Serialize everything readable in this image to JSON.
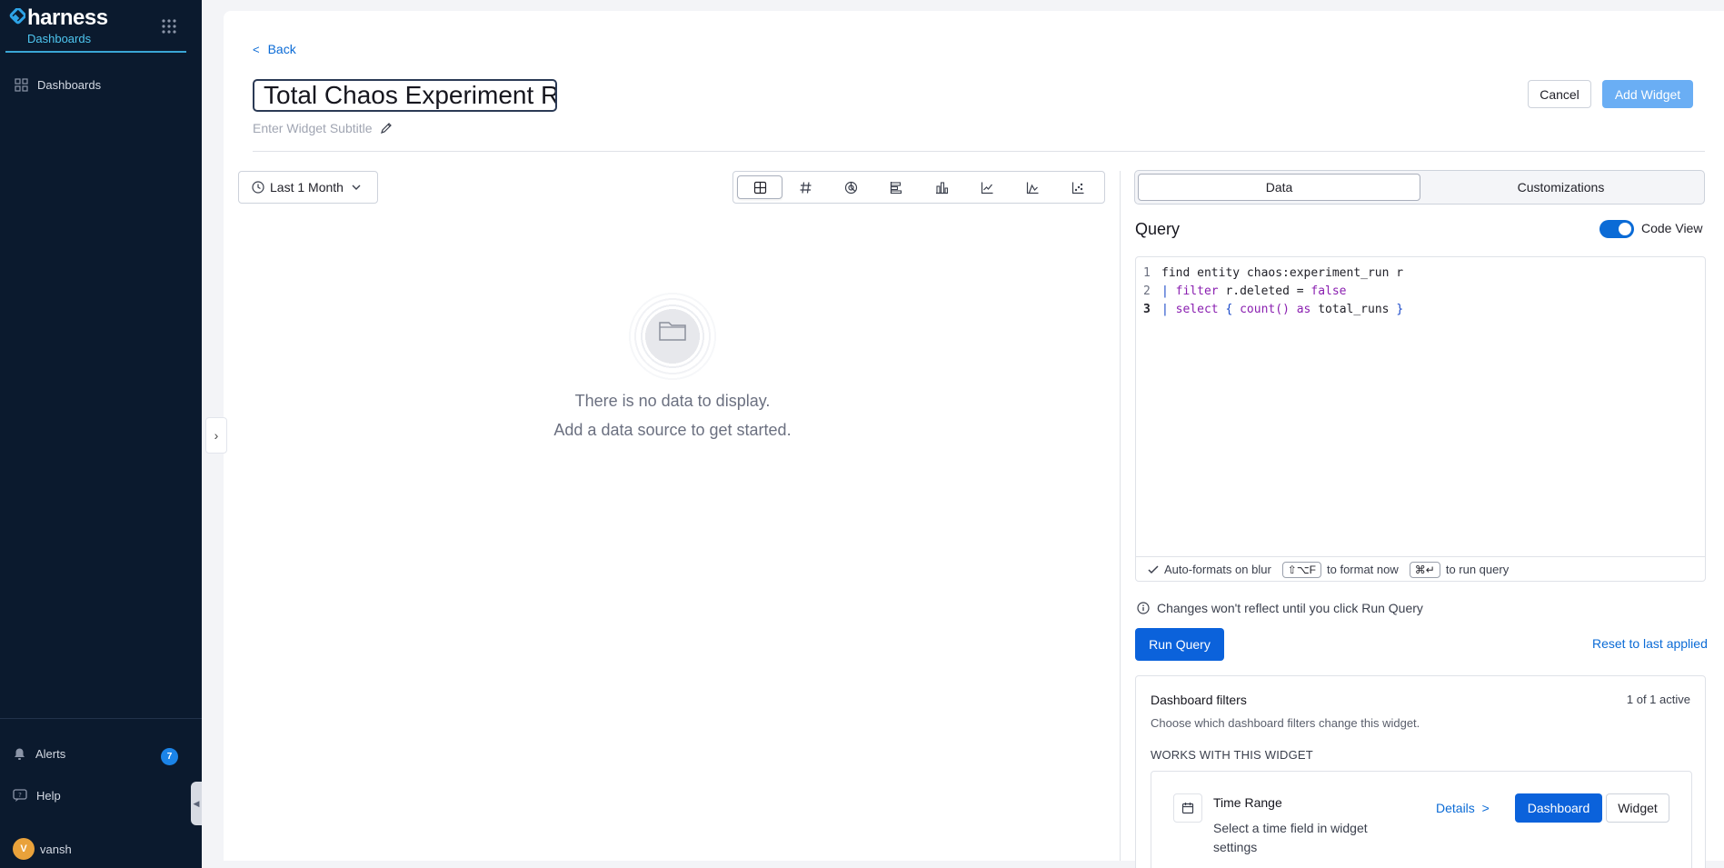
{
  "sidebar": {
    "brand": "harness",
    "module": "Dashboards",
    "nav_items": [
      {
        "label": "Dashboards",
        "icon": "dashboard-grid-icon"
      }
    ],
    "alerts_label": "Alerts",
    "alerts_count": "7",
    "help_label": "Help",
    "user_initial": "V",
    "user_name": "vansh"
  },
  "header": {
    "back_label": "Back",
    "title_value": "Total Chaos Experiment Runs",
    "subtitle_placeholder": "Enter Widget Subtitle",
    "cancel_label": "Cancel",
    "add_widget_label": "Add Widget"
  },
  "preview": {
    "time_range": "Last 1 Month",
    "chart_types": [
      "table",
      "number",
      "pie",
      "bar-horizontal",
      "bar-vertical",
      "line",
      "area",
      "scatter"
    ],
    "active_chart_type": "table",
    "empty_line1": "There is no data to display.",
    "empty_line2": "Add a data source to get started."
  },
  "editor_panel": {
    "tabs": [
      "Data",
      "Customizations"
    ],
    "active_tab": "Data",
    "query_label": "Query",
    "code_view_label": "Code View",
    "code_view_on": true,
    "code": {
      "line1_num": "1",
      "line1": "find entity chaos:experiment_run r",
      "line2_num": "2",
      "line2_pipe": "| ",
      "line2_kw": "filter",
      "line2_mid": " r.deleted = ",
      "line2_val": "false",
      "line3_num": "3",
      "line3_pipe": "| ",
      "line3_kw": "select",
      "line3_open": "{",
      "line3_fn": "count()",
      "line3_as": "as",
      "line3_alias": "total_runs",
      "line3_close": "}"
    },
    "footer": {
      "autoformat": "Auto-formats on blur",
      "format_keys": "⇧⌥F",
      "format_text": "to format now",
      "run_keys": "⌘↵",
      "run_text": "to run query"
    },
    "info_text": "Changes won't reflect until you click Run Query",
    "run_query_label": "Run Query",
    "reset_label": "Reset to last applied"
  },
  "filters": {
    "title": "Dashboard filters",
    "count": "1 of 1 active",
    "description": "Choose which dashboard filters change this widget.",
    "works_label": "WORKS WITH THIS WIDGET",
    "item": {
      "title": "Time Range",
      "description": "Select a time field in widget settings",
      "details_label": "Details",
      "dashboard_label": "Dashboard",
      "widget_label": "Widget"
    }
  },
  "colors": {
    "sidebar_bg": "#0b1a2e",
    "accent": "#0b62db",
    "add_widget_disabled": "#6aaef4",
    "link": "#0b6bd6",
    "keyword": "#8a1fb0"
  }
}
